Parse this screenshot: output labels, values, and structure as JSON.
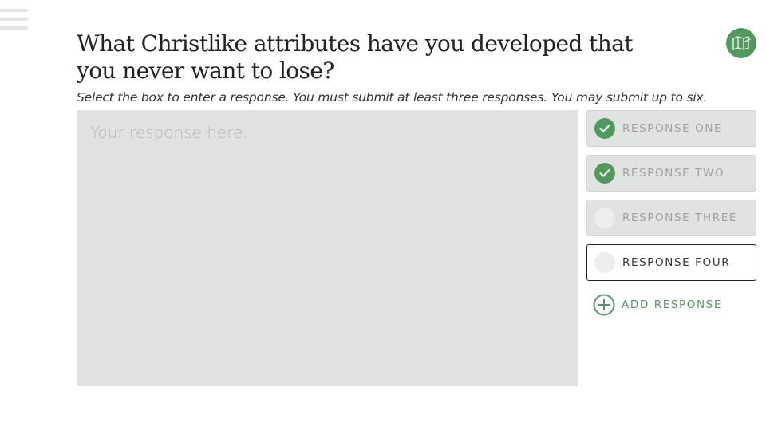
{
  "title": "What Christlike attributes have you developed that you never want to lose?",
  "instructions": "Select the box to enter a response. You must submit at least three responses. You may submit up to six.",
  "response_box": {
    "placeholder": "Your response here.",
    "value": ""
  },
  "responses": [
    {
      "label": "RESPONSE ONE",
      "completed": true,
      "active": false
    },
    {
      "label": "RESPONSE TWO",
      "completed": true,
      "active": false
    },
    {
      "label": "RESPONSE THREE",
      "completed": false,
      "active": false
    },
    {
      "label": "RESPONSE FOUR",
      "completed": false,
      "active": true
    }
  ],
  "add_response_label": "ADD RESPONSE",
  "icons": {
    "menu": "hamburger-menu-icon",
    "map": "map-icon",
    "check": "checkmark-icon",
    "add": "plus-circle-icon"
  },
  "colors": {
    "accent": "#4f9a5c",
    "panel": "#e0e3e2",
    "text": "#222222"
  }
}
